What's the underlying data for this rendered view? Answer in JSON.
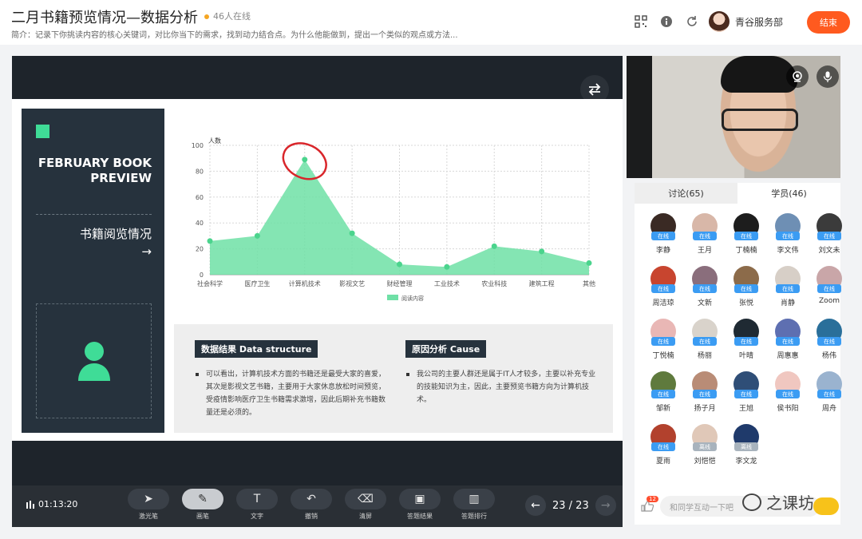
{
  "header": {
    "title": "二月书籍预览情况—数据分析",
    "online_count": "46人在线",
    "intro": "简介：记录下你挑读内容的核心关键词，对比你当下的需求，找到动力结合点。为什么他能做到，提出一个类似的观点或方法...",
    "user_name": "青谷服务部",
    "end_label": "结束"
  },
  "icons": [
    "qrcode-icon",
    "info-icon",
    "refresh-icon",
    "swap-icon",
    "camera-icon",
    "mic-icon",
    "pointer-icon",
    "pen-icon",
    "text-icon",
    "undo-icon",
    "eraser-icon",
    "stats-icon",
    "chat-icon"
  ],
  "slide": {
    "side_title": "FEBRUARY BOOK PREVIEW",
    "side_subtitle": "书籍阅览情况",
    "side_arrow": "→",
    "left_section": {
      "title": "数据结果 Data structure",
      "text": "可以看出，计算机技术方面的书籍还是最受大家的喜爱，其次是影视文艺书籍，主要用于大家休息放松时间预览，受疫情影响医疗卫生书籍需求激增，因此后期补充书籍数量还是必须的。"
    },
    "right_section": {
      "title": "原因分析 Cause",
      "text": "我公司的主要人群还是属于IT人才较多，主要以补充专业的技能知识为主，因此，主要预览书籍方向为计算机技术。"
    }
  },
  "chart_data": {
    "type": "area",
    "categories": [
      "社会科学",
      "医疗卫生",
      "计算机技术",
      "影视文艺",
      "财经管理",
      "工业技术",
      "农业科技",
      "建筑工程",
      "其他"
    ],
    "series": [
      {
        "name": "阅读内容",
        "values": [
          26,
          30,
          89,
          32,
          8,
          6,
          22,
          18,
          9
        ],
        "color": "#6fe0a6"
      }
    ],
    "ylabel": "人数",
    "ylim": [
      0,
      100
    ],
    "yticks": [
      0,
      20,
      40,
      60,
      80,
      100
    ],
    "grid": true,
    "legend_position": "bottom",
    "annotation": {
      "type": "hand-drawn circle",
      "target_category": "计算机技术",
      "color": "#d9262b"
    }
  },
  "toolbar": {
    "timer": "01:13:20",
    "tools": [
      {
        "label": "激光笔",
        "glyph": "➤"
      },
      {
        "label": "画笔",
        "glyph": "✎"
      },
      {
        "label": "文字",
        "glyph": "T"
      },
      {
        "label": "撤销",
        "glyph": "↶"
      },
      {
        "label": "清屏",
        "glyph": "⌫"
      },
      {
        "label": "答题结果",
        "glyph": "▣"
      },
      {
        "label": "答题排行",
        "glyph": "▥"
      }
    ],
    "page": "23 / 23",
    "prev": "←",
    "next": "→"
  },
  "members_panel": {
    "tabs": [
      {
        "label": "讨论(65)"
      },
      {
        "label": "学员(46)"
      }
    ],
    "members": [
      {
        "name": "李静",
        "status": "在线",
        "color": "#3a2a24"
      },
      {
        "name": "王月",
        "status": "在线",
        "color": "#d8b7a8"
      },
      {
        "name": "丁楠楠",
        "status": "在线",
        "color": "#1d1d1d"
      },
      {
        "name": "李文伟",
        "status": "在线",
        "color": "#6e8fb4"
      },
      {
        "name": "刘文未",
        "status": "在线",
        "color": "#3b3b3b"
      },
      {
        "name": "周洁琼",
        "status": "在线",
        "color": "#c8452f"
      },
      {
        "name": "文新",
        "status": "在线",
        "color": "#8a6e7c"
      },
      {
        "name": "张悦",
        "status": "在线",
        "color": "#8c6b4a"
      },
      {
        "name": "肖静",
        "status": "在线",
        "color": "#d7cfc7"
      },
      {
        "name": "Zoom",
        "status": "在线",
        "color": "#c9a6a8"
      },
      {
        "name": "丁悦楠",
        "status": "在线",
        "color": "#e9b7b5"
      },
      {
        "name": "杨丽",
        "status": "在线",
        "color": "#d9d3cb"
      },
      {
        "name": "叶晴",
        "status": "在线",
        "color": "#1f2a33"
      },
      {
        "name": "周惠惠",
        "status": "在线",
        "color": "#5e6fb1"
      },
      {
        "name": "杨伟",
        "status": "在线",
        "color": "#2a6f9a"
      },
      {
        "name": "邹新",
        "status": "在线",
        "color": "#5f7a3d"
      },
      {
        "name": "扬子月",
        "status": "在线",
        "color": "#b98c76"
      },
      {
        "name": "王旭",
        "status": "在线",
        "color": "#2f4e77"
      },
      {
        "name": "侯书阳",
        "status": "在线",
        "color": "#f0c7c0"
      },
      {
        "name": "周舟",
        "status": "在线",
        "color": "#9ab3cf"
      },
      {
        "name": "夏雨",
        "status": "在线",
        "color": "#b2412d"
      },
      {
        "name": "刘恺恺",
        "status": "离线",
        "color": "#e0c8b8"
      },
      {
        "name": "李文龙",
        "status": "离线",
        "color": "#1f3a6b"
      }
    ],
    "chat_badge": "12",
    "chat_placeholder": "和同学互动一下吧"
  },
  "watermark": "之课坊"
}
